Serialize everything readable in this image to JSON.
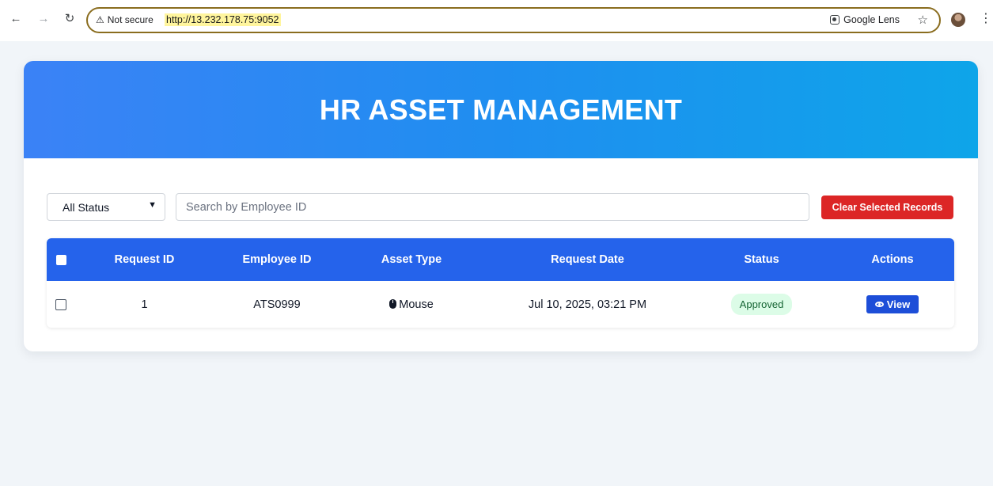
{
  "browser": {
    "security_label": "Not secure",
    "url": "http://13.232.178.75:9052",
    "lens_label": "Google Lens"
  },
  "header": {
    "title": "HR ASSET MANAGEMENT"
  },
  "filters": {
    "status_selected": "All Status",
    "search_placeholder": "Search by Employee ID",
    "clear_label": "Clear Selected Records"
  },
  "table": {
    "columns": [
      "Request ID",
      "Employee ID",
      "Asset Type",
      "Request Date",
      "Status",
      "Actions"
    ],
    "rows": [
      {
        "request_id": "1",
        "employee_id": "ATS0999",
        "asset_type": "Mouse",
        "request_date": "Jul 10, 2025, 03:21 PM",
        "status": "Approved",
        "action": "View"
      }
    ]
  },
  "colors": {
    "header_gradient_start": "#3b82f6",
    "header_gradient_end": "#0ea5e9",
    "table_header": "#2563eb",
    "clear_button": "#dc2626",
    "status_approved_bg": "#dcfce7",
    "view_button": "#1d4ed8"
  }
}
